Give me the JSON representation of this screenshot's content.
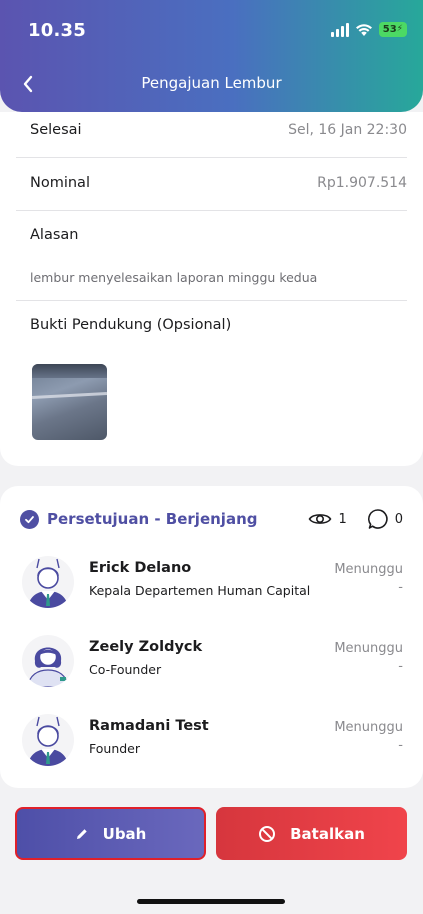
{
  "status_bar": {
    "time": "10.35",
    "battery": "53"
  },
  "header": {
    "title": "Pengajuan Lembur"
  },
  "details": {
    "end_label": "Selesai",
    "end_value": "Sel, 16 Jan 22:30",
    "nominal_label": "Nominal",
    "nominal_value": "Rp1.907.514",
    "reason_label": "Alasan",
    "reason_value": "lembur menyelesaikan laporan minggu kedua",
    "evidence_label": "Bukti Pendukung (Opsional)"
  },
  "approval": {
    "title": "Persetujuan - Berjenjang",
    "views": "1",
    "comments": "0",
    "approvers": [
      {
        "name": "Erick Delano",
        "role": "Kepala Departemen Human Capital",
        "status": "Menunggu",
        "date": "-"
      },
      {
        "name": "Zeely Zoldyck",
        "role": "Co-Founder",
        "status": "Menunggu",
        "date": "-"
      },
      {
        "name": "Ramadani Test",
        "role": "Founder",
        "status": "Menunggu",
        "date": "-"
      }
    ]
  },
  "actions": {
    "edit_label": "Ubah",
    "cancel_label": "Batalkan"
  },
  "colors": {
    "accent": "#4f4fa3",
    "danger": "#e03c42",
    "teal": "#27a89a"
  }
}
